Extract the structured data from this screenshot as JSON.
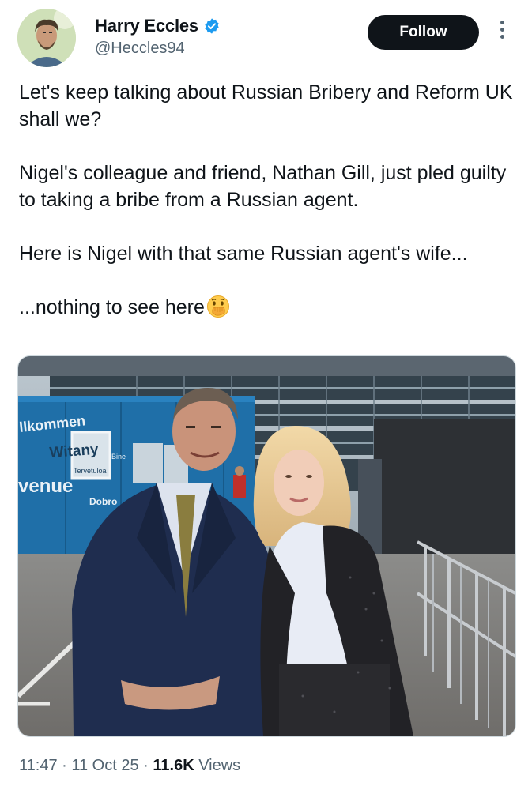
{
  "author": {
    "display_name": "Harry Eccles",
    "handle": "@Heccles94",
    "verified": true,
    "avatar_icon": "user-avatar"
  },
  "actions": {
    "follow_label": "Follow",
    "more_icon": "vertical-ellipsis-icon"
  },
  "tweet": {
    "paragraphs": [
      "Let's keep talking about Russian Bribery and Reform UK shall we?",
      "Nigel's colleague and friend, Nathan Gill, just pled guilty to taking a bribe from a Russian agent.",
      "Here is Nigel with that same Russian agent's wife...",
      "...nothing to see here"
    ],
    "emoji": "face-with-hand-over-mouth"
  },
  "media": {
    "sign_line1": "llkommen",
    "sign_line2": "Witany",
    "sign_line3": "venue",
    "sign_line4": "Dobro",
    "sign_small1": "Tervetuloa",
    "sign_small2": "Bine"
  },
  "meta": {
    "time": "11:47",
    "sep1": " · ",
    "date": "11 Oct 25",
    "sep2": " · ",
    "views_count": "11.6K",
    "views_label": " Views"
  },
  "colors": {
    "verified_blue": "#1d9bf0",
    "follow_bg": "#0f1419",
    "secondary_text": "#536471"
  }
}
